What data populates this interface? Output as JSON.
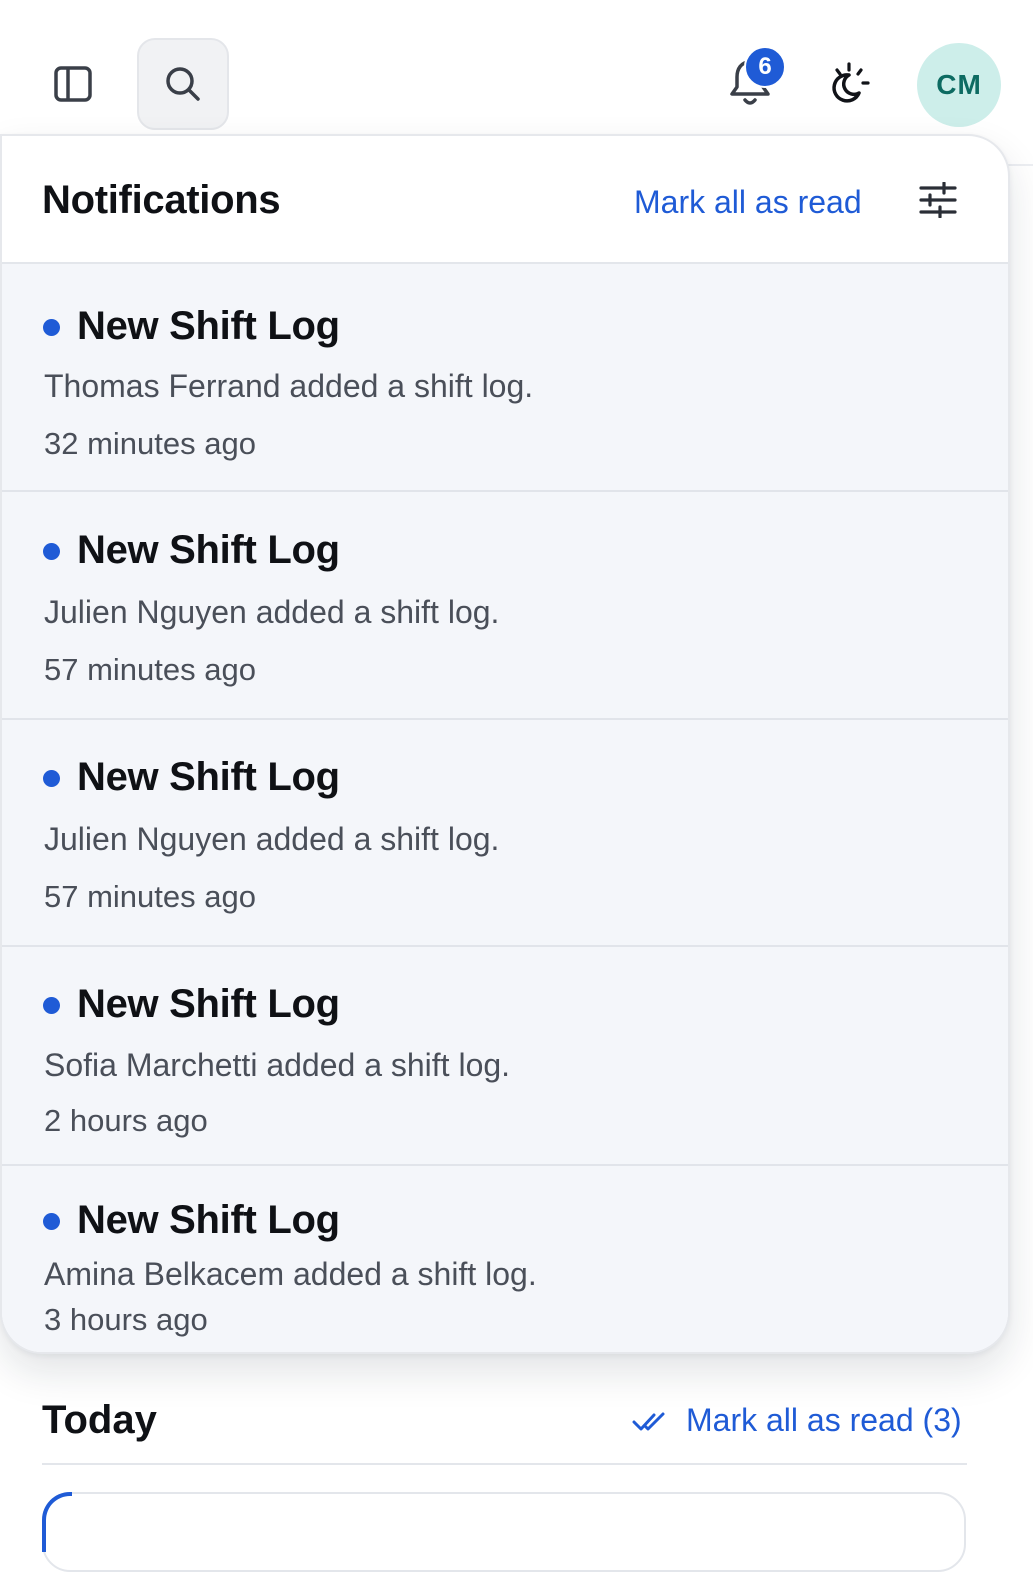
{
  "topbar": {
    "notification_count": "6",
    "avatar_initials": "CM"
  },
  "notifications": {
    "title": "Notifications",
    "mark_all_label": "Mark all as read",
    "items": [
      {
        "title": "New Shift Log",
        "message": "Thomas Ferrand added a shift log.",
        "time": "32 minutes ago",
        "unread": true
      },
      {
        "title": "New Shift Log",
        "message": "Julien Nguyen added a shift log.",
        "time": "57 minutes ago",
        "unread": true
      },
      {
        "title": "New Shift Log",
        "message": "Julien Nguyen added a shift log.",
        "time": "57 minutes ago",
        "unread": true
      },
      {
        "title": "New Shift Log",
        "message": "Sofia Marchetti added a shift log.",
        "time": "2 hours ago",
        "unread": true
      },
      {
        "title": "New Shift Log",
        "message": "Amina Belkacem added a shift log.",
        "time": "3 hours ago",
        "unread": true
      }
    ]
  },
  "today": {
    "title": "Today",
    "mark_all_label": "Mark all as read (3)"
  },
  "colors": {
    "accent": "#1f5bd6",
    "avatar_bg": "#cdeeea",
    "avatar_text": "#0d6b62",
    "unread_bg": "#f4f6fa"
  },
  "icons": {
    "sidebar": "sidebar-toggle-icon",
    "search": "search-icon",
    "bell": "bell-icon",
    "theme": "sun-moon-icon",
    "filter": "sliders-icon",
    "double_check": "double-check-icon"
  }
}
